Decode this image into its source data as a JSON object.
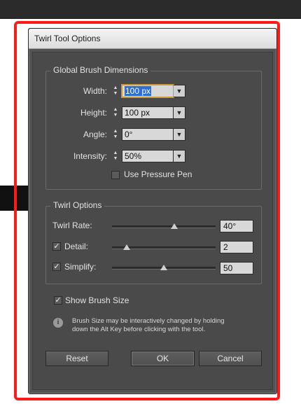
{
  "dialog": {
    "title": "Twirl Tool Options"
  },
  "global": {
    "legend": "Global Brush Dimensions",
    "rows": [
      {
        "label": "Width:",
        "value": "100 px"
      },
      {
        "label": "Height:",
        "value": "100 px"
      },
      {
        "label": "Angle:",
        "value": "0°"
      },
      {
        "label": "Intensity:",
        "value": "50%"
      }
    ],
    "pressure_pen": {
      "label": "Use Pressure Pen",
      "checked": false
    }
  },
  "twirl": {
    "legend": "Twirl Options",
    "rate": {
      "label": "Twirl Rate:",
      "value": "40°",
      "slider": 0.6
    },
    "detail": {
      "label": "Detail:",
      "value": "2",
      "checked": true,
      "slider": 0.14
    },
    "simplify": {
      "label": "Simplify:",
      "value": "50",
      "checked": true,
      "slider": 0.5
    }
  },
  "show_brush": {
    "label": "Show Brush Size",
    "checked": true
  },
  "info": {
    "icon": "info-icon",
    "text": "Brush Size may be interactively changed by holding down the Alt Key before clicking with the tool."
  },
  "buttons": {
    "reset": "Reset",
    "ok": "OK",
    "cancel": "Cancel"
  },
  "colors": {
    "frame": "#ff1a1a",
    "dialog_bg": "#535353",
    "focus": "#c89a3c",
    "selection": "#2f6fd0"
  }
}
